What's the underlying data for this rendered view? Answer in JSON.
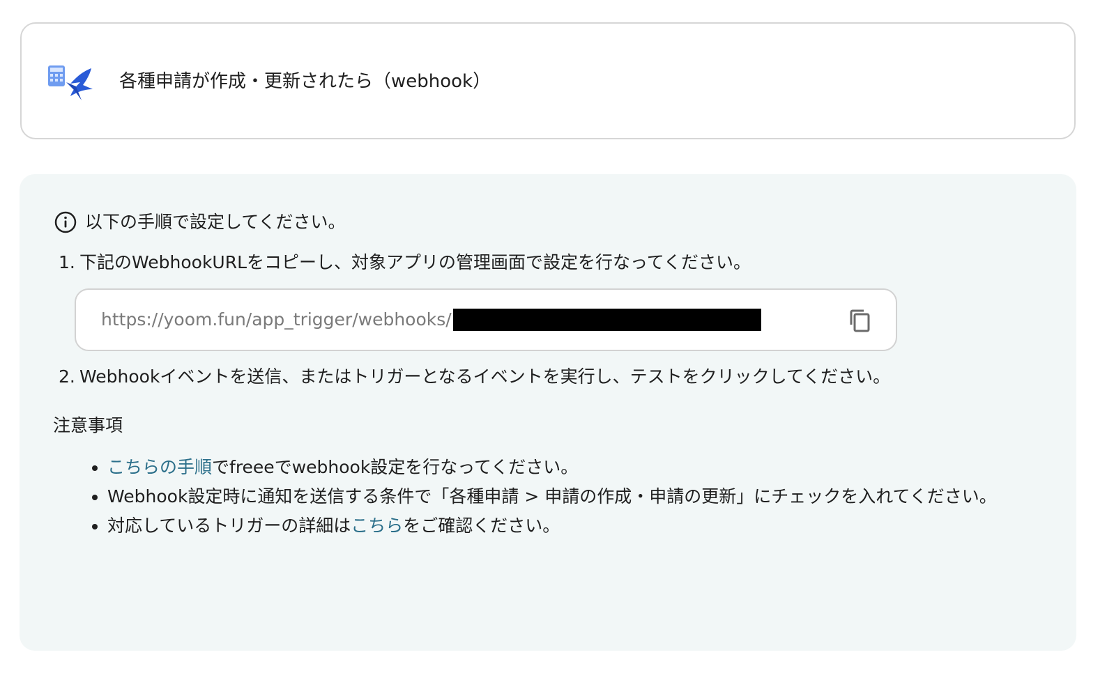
{
  "trigger": {
    "icon": "freee-calculator-bird-icon",
    "title": "各種申請が作成・更新されたら（webhook）"
  },
  "info": {
    "icon": "info-icon",
    "heading": "以下の手順で設定してください。",
    "steps": [
      {
        "num": "1.",
        "text": "下記のWebhookURLをコピーし、対象アプリの管理画面で設定を行なってください。"
      },
      {
        "num": "2.",
        "text": "Webhookイベントを送信、またはトリガーとなるイベントを実行し、テストをクリックしてください。"
      }
    ],
    "url": {
      "value": "https://yoom.fun/app_trigger/webhooks/",
      "copy_icon": "copy-icon"
    }
  },
  "notes": {
    "heading": "注意事項",
    "items": [
      {
        "link": "こちらの手順",
        "text": "でfreeeでwebhook設定を行なってください。"
      },
      {
        "text": "Webhook設定時に通知を送信する条件で「各種申請 > 申請の作成・申請の更新」にチェックを入れてください。"
      },
      {
        "before": "対応しているトリガーの詳細は",
        "link": "こちら",
        "after": "をご確認ください。"
      }
    ]
  },
  "colors": {
    "panel_bg": "#f2f7f7",
    "link": "#2b6f8a",
    "icon_blue": "#2a5bd7"
  }
}
